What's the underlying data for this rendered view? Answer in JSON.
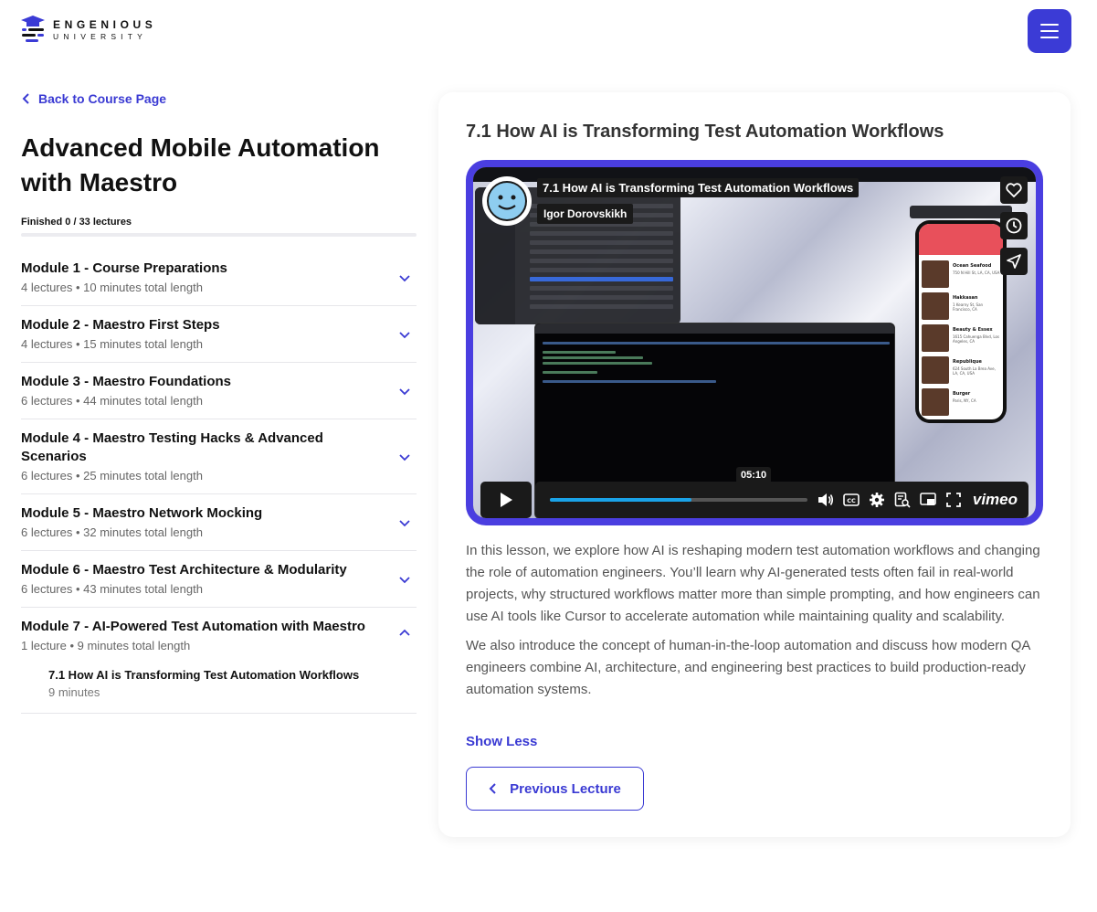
{
  "brand": {
    "line1": "ENGENIOUS",
    "line2": "UNIVERSITY",
    "accent": "#3b3bd6"
  },
  "header": {
    "menu_icon": "hamburger-icon"
  },
  "sidebar": {
    "back_label": "Back to Course Page",
    "course_title": "Advanced Mobile Automation with Maestro",
    "progress_text": "Finished 0 / 33 lectures",
    "progress_fraction": 0,
    "modules": [
      {
        "title": "Module 1 - Course Preparations",
        "meta": "4 lectures • 10 minutes total length",
        "expanded": false
      },
      {
        "title": "Module 2 - Maestro First Steps",
        "meta": "4 lectures • 15 minutes total length",
        "expanded": false
      },
      {
        "title": "Module 3 - Maestro Foundations",
        "meta": "6 lectures • 44 minutes total length",
        "expanded": false
      },
      {
        "title": "Module 4 - Maestro Testing Hacks & Advanced Scenarios",
        "meta": "6 lectures • 25 minutes total length",
        "expanded": false
      },
      {
        "title": "Module 5 - Maestro Network Mocking",
        "meta": "6 lectures • 32 minutes total length",
        "expanded": false
      },
      {
        "title": "Module 6 - Maestro Test Architecture & Modularity",
        "meta": "6 lectures • 43 minutes total length",
        "expanded": false
      },
      {
        "title": "Module 7 - AI-Powered Test Automation with Maestro",
        "meta": "1 lecture • 9 minutes total length",
        "expanded": true,
        "lectures": [
          {
            "title": "7.1 How AI is Transforming Test Automation Workflows",
            "duration": "9 minutes"
          }
        ]
      }
    ]
  },
  "lesson": {
    "title": "7.1 How AI is Transforming Test Automation Workflows",
    "video": {
      "title": "7.1 How AI is Transforming Test Automation Workflows",
      "author": "Igor Dorovskikh",
      "current_time": "05:10",
      "progress_fraction": 0.55,
      "brand": "vimeo",
      "side_icons": [
        "heart-icon",
        "clock-icon",
        "send-icon"
      ],
      "control_icons": [
        "volume-icon",
        "captions-icon",
        "settings-icon",
        "transcript-icon",
        "pip-icon",
        "fullscreen-icon"
      ],
      "phone_items": [
        {
          "name": "Ocean Seafood",
          "addr": "750 N Hill St, LA, CA, USA"
        },
        {
          "name": "Hakkasan",
          "addr": "1 Kearny St, San Francisco, CA"
        },
        {
          "name": "Beauty & Essex",
          "addr": "1615 Cahuenga Blvd, Los Angeles, CA"
        },
        {
          "name": "Republique",
          "addr": "624 South La Brea Ave, LA, CA, USA"
        },
        {
          "name": "Burger",
          "addr": "Paris, NY, CA"
        }
      ]
    },
    "description": [
      "In this lesson, we explore how AI is reshaping modern test automation workflows and changing the role of automation engineers. You’ll learn why AI-generated tests often fail in real-world projects, why structured workflows matter more than simple prompting, and how engineers can use AI tools like Cursor to accelerate automation while maintaining quality and scalability.",
      "We also introduce the concept of human-in-the-loop automation and discuss how modern QA engineers combine AI, architecture, and engineering best practices to build production-ready automation systems."
    ],
    "show_less_label": "Show Less",
    "previous_label": "Previous Lecture"
  }
}
